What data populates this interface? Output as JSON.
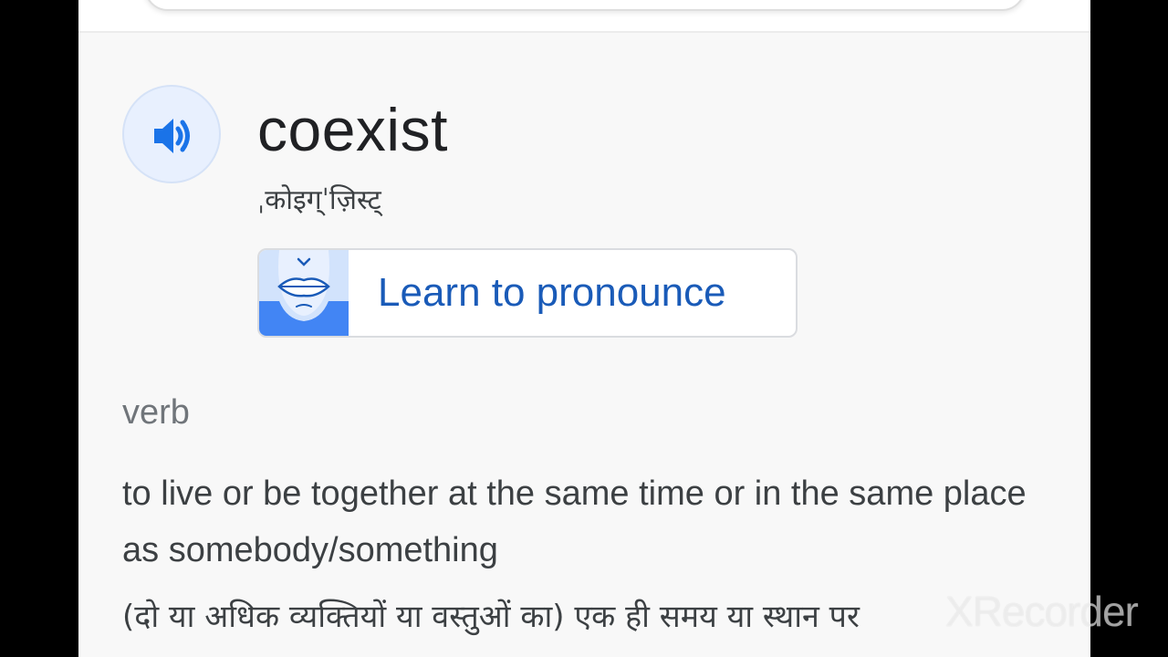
{
  "entry": {
    "word": "coexist",
    "phonetic": "ˌकोइग्ˈज़िस्ट्",
    "speaker_icon": "volume-icon",
    "learn_button": {
      "label": "Learn to pronounce",
      "icon": "lips-face-icon"
    },
    "part_of_speech": "verb",
    "definition": "to live or be together at the same time or in the same place as somebody/something",
    "translation": "(दो या अधिक व्यक्तियों या वस्तुओं का) एक ही समय या स्थान पर"
  },
  "watermark": {
    "text": "XRecorder"
  },
  "colors": {
    "accent_blue": "#1a73e8",
    "link_blue": "#1a5bb8",
    "speaker_bg": "#e8f0fe",
    "text_dark": "#202124",
    "text_muted": "#70757a"
  }
}
